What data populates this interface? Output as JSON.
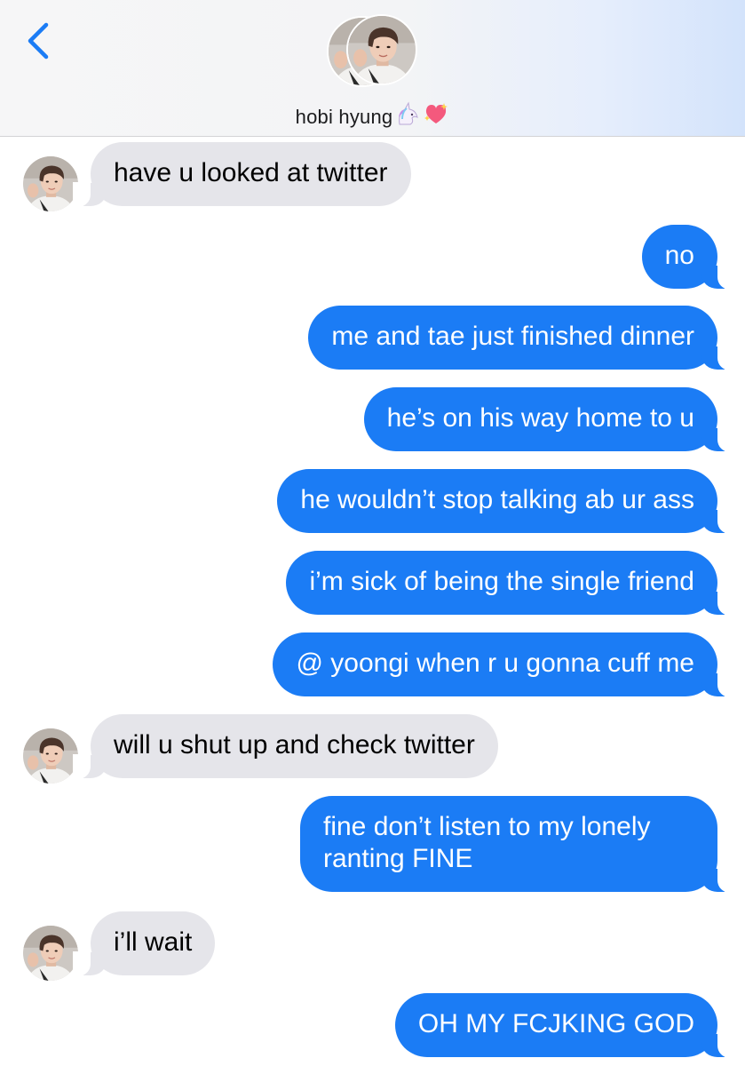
{
  "header": {
    "contact_name": "hobi hyung",
    "name_emojis": [
      "unicorn-emoji",
      "sparkling-heart-emoji"
    ],
    "back_icon": "chevron-left-icon",
    "accent_color": "#1b7cf5"
  },
  "messages": [
    {
      "direction": "incoming",
      "text": "have u looked at twitter",
      "show_avatar": true
    },
    {
      "direction": "outgoing",
      "text": "no"
    },
    {
      "direction": "outgoing",
      "text": "me and tae just finished dinner"
    },
    {
      "direction": "outgoing",
      "text": "he’s on his way home to u"
    },
    {
      "direction": "outgoing",
      "text": "he wouldn’t stop talking ab ur ass"
    },
    {
      "direction": "outgoing",
      "text": "i’m sick of being the single friend"
    },
    {
      "direction": "outgoing",
      "text": "@ yoongi when r u gonna cuff me"
    },
    {
      "direction": "incoming",
      "text": "will u shut up and check twitter",
      "show_avatar": true
    },
    {
      "direction": "outgoing",
      "text": "fine don’t listen to my lonely ranting FINE"
    },
    {
      "direction": "incoming",
      "text": "i’ll wait",
      "show_avatar": true
    },
    {
      "direction": "outgoing",
      "text": "OH MY FCJKING GOD"
    }
  ],
  "colors": {
    "incoming_bubble": "#e5e5ea",
    "outgoing_bubble": "#1b7cf5",
    "outgoing_text": "#ffffff",
    "incoming_text": "#000000"
  }
}
